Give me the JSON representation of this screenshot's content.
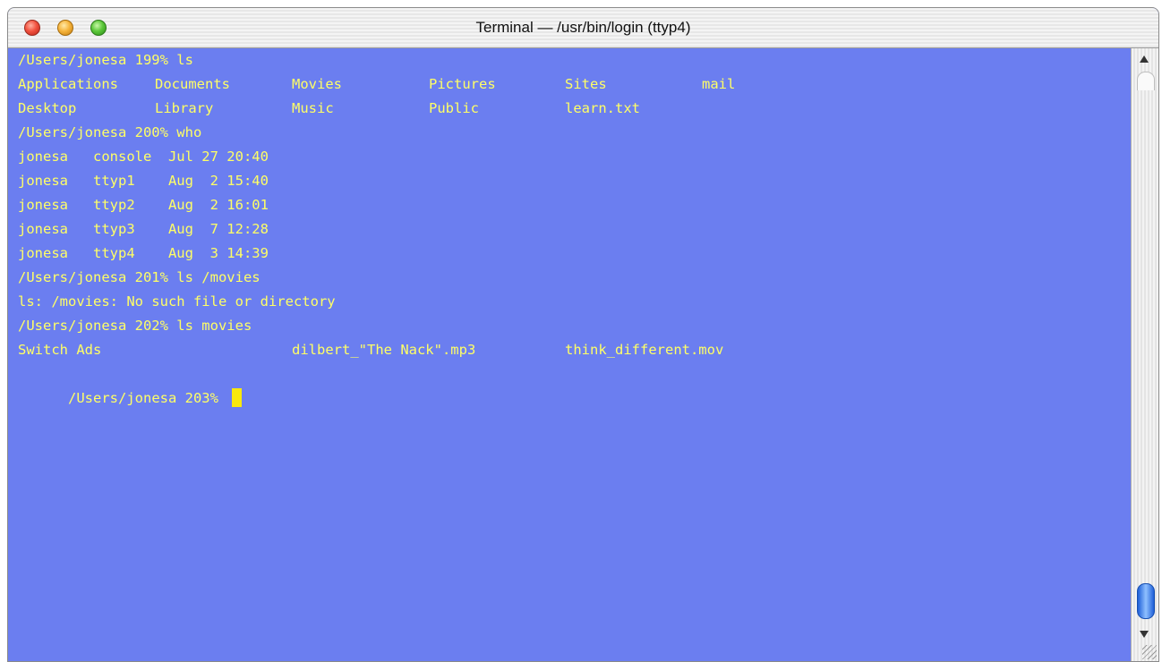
{
  "window": {
    "title": "Terminal  —  /usr/bin/login (ttyp4)",
    "colors": {
      "background": "#6b7ef0",
      "text": "#ffff66",
      "cursor": "#f8e80d"
    }
  },
  "terminal": {
    "lines": [
      {
        "cols": [
          "/Users/jonesa 199% ls"
        ]
      },
      {
        "cols": [
          "Applications",
          "Documents",
          "Movies",
          "Pictures",
          "Sites",
          "mail"
        ]
      },
      {
        "cols": [
          "Desktop",
          "Library",
          "Music",
          "Public",
          "learn.txt"
        ]
      },
      {
        "cols": [
          "/Users/jonesa 200% who"
        ]
      },
      {
        "cols": [
          "jonesa   console  Jul 27 20:40"
        ]
      },
      {
        "cols": [
          "jonesa   ttyp1    Aug  2 15:40"
        ]
      },
      {
        "cols": [
          "jonesa   ttyp2    Aug  2 16:01"
        ]
      },
      {
        "cols": [
          "jonesa   ttyp3    Aug  7 12:28"
        ]
      },
      {
        "cols": [
          "jonesa   ttyp4    Aug  3 14:39"
        ]
      },
      {
        "cols": [
          "/Users/jonesa 201% ls /movies"
        ]
      },
      {
        "cols": [
          "ls: /movies: No such file or directory"
        ]
      },
      {
        "cols": [
          "/Users/jonesa 202% ls movies"
        ]
      },
      {
        "cols": [
          "Switch Ads",
          "dilbert_\"The Nack\".mp3",
          "think_different.mov"
        ]
      },
      {
        "cols": [
          "/Users/jonesa 203% "
        ]
      }
    ],
    "prompt_active": "/Users/jonesa 203% "
  },
  "icons": {
    "close": "close-icon",
    "minimize": "minimize-icon",
    "zoom": "zoom-icon",
    "scroll_up": "arrow-up-icon",
    "scroll_down": "arrow-down-icon",
    "resize": "resize-grip-icon"
  }
}
